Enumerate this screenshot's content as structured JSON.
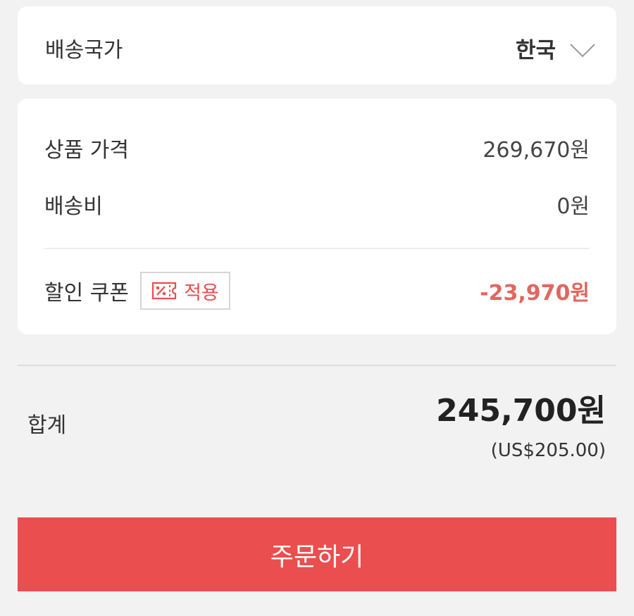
{
  "shipping_country": {
    "label": "배송국가",
    "value": "한국",
    "icon": "chevron-down-icon"
  },
  "summary": {
    "product_price_label": "상품 가격",
    "product_price_value": "269,670원",
    "shipping_fee_label": "배송비",
    "shipping_fee_value": "0원",
    "coupon_label": "할인 쿠폰",
    "coupon_button_label": "적용",
    "coupon_icon": "coupon-icon",
    "discount_value": "-23,970원"
  },
  "total": {
    "label": "합계",
    "amount": "245,700원",
    "usd": "(US$205.00)"
  },
  "order_button_label": "주문하기",
  "colors": {
    "accent": "#ea4e4e",
    "discount": "#e0675f",
    "background": "#f2f2f2",
    "card": "#ffffff"
  }
}
